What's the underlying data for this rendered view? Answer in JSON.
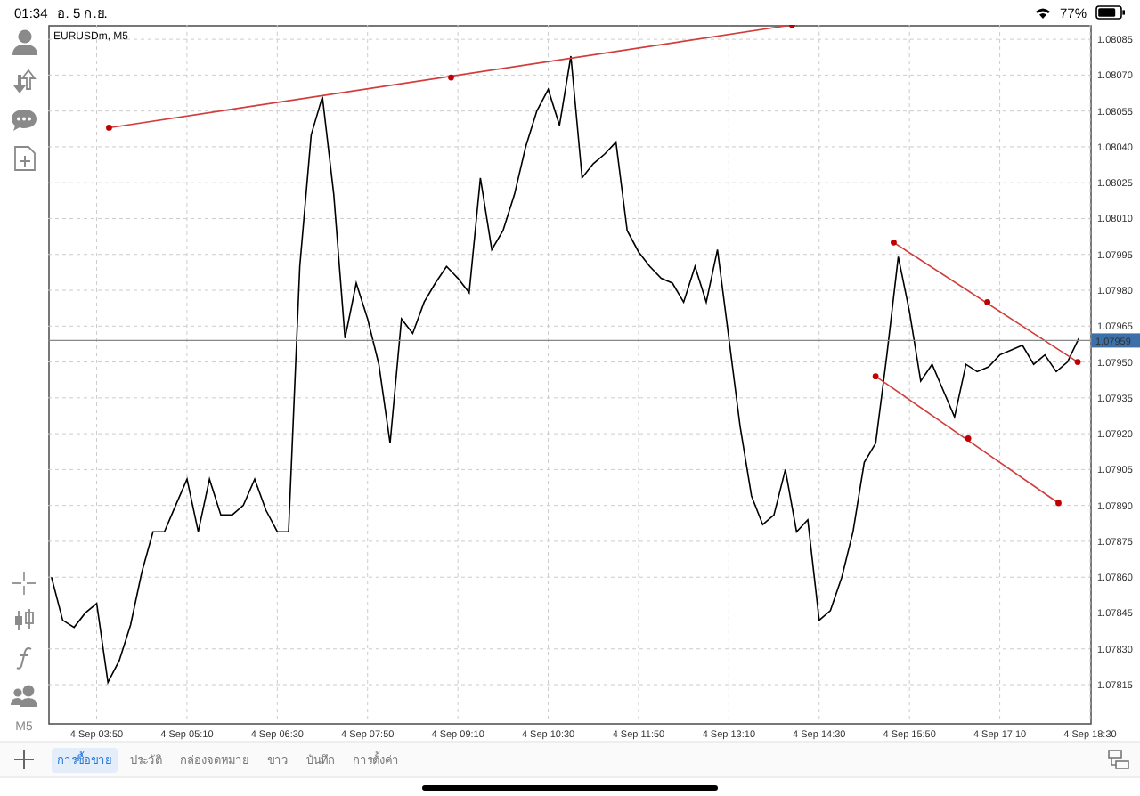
{
  "status_bar": {
    "time": "01:34",
    "date": "อ. 5 ก.ย.",
    "battery": "77%"
  },
  "toolbar": {
    "timeframe": "M5"
  },
  "chart": {
    "title": "EURUSDm, M5",
    "chart_data": {
      "type": "line",
      "categories": [
        null,
        null,
        null,
        null,
        "4 Sep 03:50",
        null,
        null,
        null,
        null,
        null,
        null,
        null,
        "4 Sep 05:10",
        null,
        null,
        null,
        null,
        null,
        null,
        null,
        "4 Sep 06:30",
        null,
        null,
        null,
        null,
        null,
        null,
        null,
        "4 Sep 07:50",
        null,
        null,
        null,
        null,
        null,
        null,
        null,
        "4 Sep 09:10",
        null,
        null,
        null,
        null,
        null,
        null,
        null,
        "4 Sep 10:30",
        null,
        null,
        null,
        null,
        null,
        null,
        null,
        "4 Sep 11:50",
        null,
        null,
        null,
        null,
        null,
        null,
        null,
        "4 Sep 13:10",
        null,
        null,
        null,
        null,
        null,
        null,
        null,
        "4 Sep 14:30",
        null,
        null,
        null,
        null,
        null,
        null,
        null,
        "4 Sep 15:50",
        null,
        null,
        null,
        null,
        null,
        null,
        null,
        "4 Sep 17:10",
        null,
        null,
        null,
        null,
        null,
        null,
        null,
        "4 Sep 18:30"
      ],
      "series": [
        {
          "color": "#000000",
          "values": [
            1.0786,
            1.07842,
            1.07839,
            1.07845,
            1.07849,
            1.07816,
            1.07825,
            1.0784,
            1.07862,
            1.07879,
            1.07879,
            1.0789,
            1.07901,
            1.07879,
            1.07901,
            1.07886,
            1.07886,
            1.0789,
            1.07901,
            1.07888,
            1.07879,
            1.07879,
            1.0799,
            1.08045,
            1.08061,
            1.0802,
            1.0796,
            1.07983,
            1.07968,
            1.07949,
            1.07916,
            1.07968,
            1.07962,
            1.07975,
            1.07983,
            1.0799,
            1.07985,
            1.07979,
            1.08027,
            1.07997,
            1.08005,
            1.0802,
            1.0804,
            1.08055,
            1.08064,
            1.08049,
            1.08078,
            1.08027,
            1.08033,
            1.08037,
            1.08042,
            1.08005,
            1.07996,
            1.0799,
            1.07985,
            1.07983,
            1.07975,
            1.0799,
            1.07975,
            1.07997,
            1.0796,
            1.07923,
            1.07894,
            1.07882,
            1.07886,
            1.07905,
            1.07879,
            1.07884,
            1.07842,
            1.07846,
            1.0786,
            1.07879,
            1.07908,
            1.07916,
            1.07953,
            1.07994,
            1.07971,
            1.07942,
            1.07949,
            1.07938,
            1.07927,
            1.07949,
            1.07946,
            1.07948,
            1.07953,
            1.07955,
            1.07957,
            1.07949,
            1.07953,
            1.07946,
            1.0795,
            1.0796,
            null
          ]
        }
      ],
      "ylim": [
        1.07799,
        1.08091
      ],
      "grid": true,
      "yticks": [
        {
          "value": 1.08085,
          "label": "1.08085"
        },
        {
          "value": 1.0807,
          "label": "1.08070"
        },
        {
          "value": 1.08055,
          "label": "1.08055"
        },
        {
          "value": 1.0804,
          "label": "1.08040"
        },
        {
          "value": 1.08025,
          "label": "1.08025"
        },
        {
          "value": 1.0801,
          "label": "1.08010"
        },
        {
          "value": 1.07995,
          "label": "1.07995"
        },
        {
          "value": 1.0798,
          "label": "1.07980"
        },
        {
          "value": 1.07965,
          "label": "1.07965"
        },
        {
          "value": 1.0795,
          "label": "1.07950"
        },
        {
          "value": 1.07935,
          "label": "1.07935"
        },
        {
          "value": 1.0792,
          "label": "1.07920"
        },
        {
          "value": 1.07905,
          "label": "1.07905"
        },
        {
          "value": 1.0789,
          "label": "1.07890"
        },
        {
          "value": 1.07875,
          "label": "1.07875"
        },
        {
          "value": 1.0786,
          "label": "1.07860"
        },
        {
          "value": 1.07845,
          "label": "1.07845"
        },
        {
          "value": 1.0783,
          "label": "1.07830"
        },
        {
          "value": 1.07815,
          "label": "1.07815"
        }
      ]
    },
    "current_price": "1.07959"
  },
  "tabs": [
    {
      "label": "การซื้อขาย",
      "selected": true
    },
    {
      "label": "ประวัติ",
      "selected": false
    },
    {
      "label": "กล่องจดหมาย",
      "selected": false
    },
    {
      "label": "ข่าว",
      "selected": false
    },
    {
      "label": "บันทึก",
      "selected": false
    },
    {
      "label": "การตั้งค่า",
      "selected": false
    }
  ]
}
